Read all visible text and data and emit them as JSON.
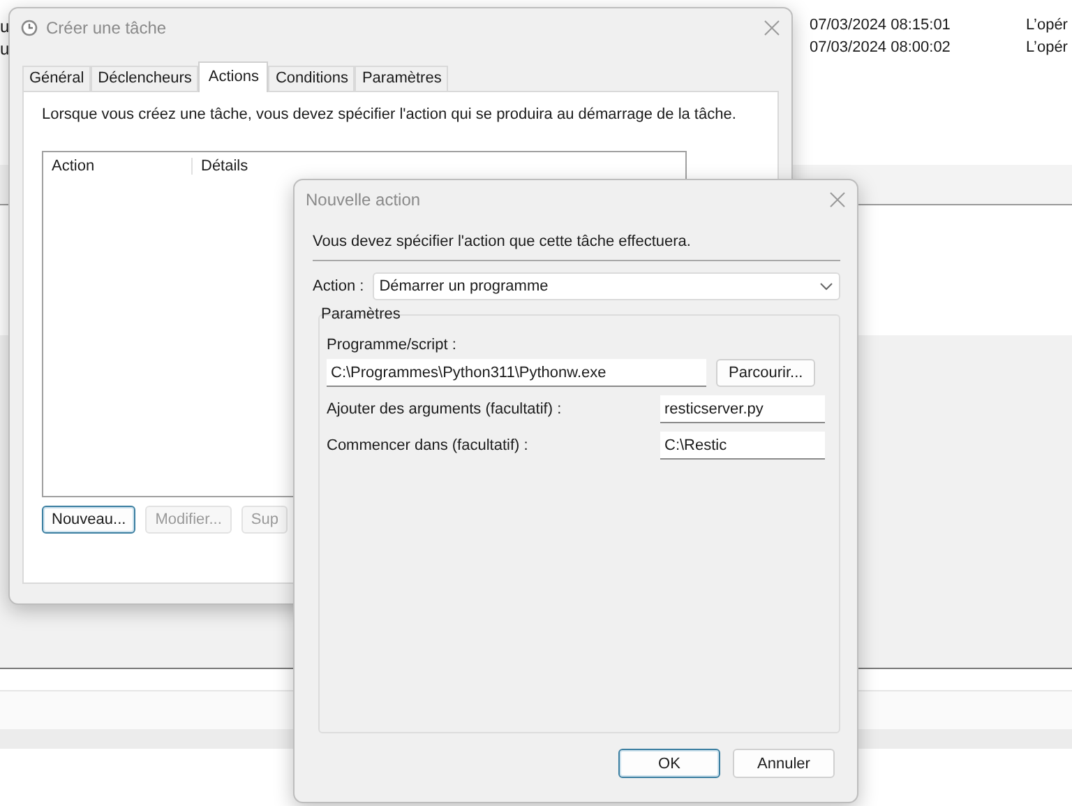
{
  "background_window": {
    "left_fragments": [
      "u",
      "u"
    ],
    "rows": [
      {
        "date": "07/03/2024 08:15:01",
        "message": "L’opér"
      },
      {
        "date": "07/03/2024 08:00:02",
        "message": "L’opér"
      }
    ]
  },
  "task_dialog": {
    "title": "Créer une tâche",
    "tabs": [
      {
        "label": "Général",
        "selected": false
      },
      {
        "label": "Déclencheurs",
        "selected": false
      },
      {
        "label": "Actions",
        "selected": true
      },
      {
        "label": "Conditions",
        "selected": false
      },
      {
        "label": "Paramètres",
        "selected": false
      }
    ],
    "description": "Lorsque vous créez une tâche, vous devez spécifier l'action qui se produira au démarrage de la tâche.",
    "columns": [
      "Action",
      "Détails"
    ],
    "buttons": [
      {
        "label": "Nouveau...",
        "focused": true,
        "disabled": false
      },
      {
        "label": "Modifier...",
        "focused": false,
        "disabled": true
      },
      {
        "label": "Sup",
        "focused": false,
        "disabled": true
      }
    ]
  },
  "action_dialog": {
    "title": "Nouvelle action",
    "description": "Vous devez spécifier l'action que cette tâche effectuera.",
    "action_label": "Action :",
    "action_value": "Démarrer un programme",
    "group_title": "Paramètres",
    "program_label": "Programme/script :",
    "program_value": "C:\\Programmes\\Python311\\Pythonw.exe",
    "browse_button": "Parcourir...",
    "fields": [
      {
        "label": "Ajouter des arguments (facultatif) :",
        "value": "resticserver.py"
      },
      {
        "label": "Commencer dans (facultatif) :",
        "value": "C:\\Restic"
      }
    ],
    "buttons": [
      {
        "label": "OK",
        "focused": true
      },
      {
        "label": "Annuler",
        "focused": false
      }
    ]
  }
}
